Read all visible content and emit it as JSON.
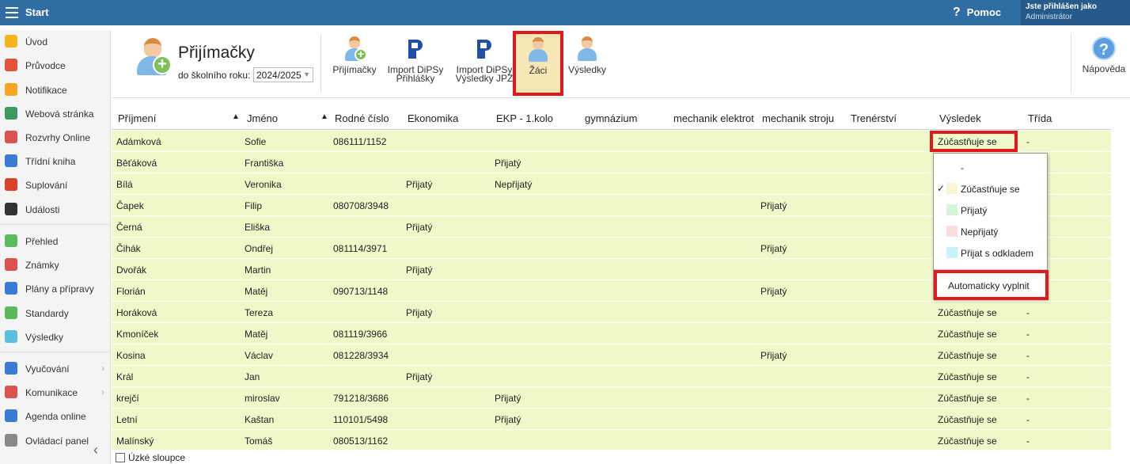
{
  "topbar": {
    "title": "Start",
    "help": "Pomoc",
    "user_line1": "Jste přihlášen jako",
    "user_line2": "Administrátor"
  },
  "sidebar": {
    "items": [
      {
        "label": "Úvod",
        "icon": "star-icon",
        "color": "#f3b51b"
      },
      {
        "label": "Průvodce",
        "icon": "wand-icon",
        "color": "#e2533a"
      },
      {
        "label": "Notifikace",
        "icon": "envelope-icon",
        "color": "#f5a623"
      },
      {
        "label": "Webová stránka",
        "icon": "home-icon",
        "color": "#3c9a5f"
      },
      {
        "label": "Rozvrhy Online",
        "icon": "calendar-grid-icon",
        "color": "#d9534f"
      },
      {
        "label": "Třídní kniha",
        "icon": "book-icon",
        "color": "#3a7bd5"
      },
      {
        "label": "Suplování",
        "icon": "person-swap-icon",
        "color": "#d9412b"
      },
      {
        "label": "Události",
        "icon": "calendar-icon",
        "color": "#333333"
      },
      {
        "label": "Přehled",
        "icon": "check-circle-icon",
        "color": "#5cb85c"
      },
      {
        "label": "Známky",
        "icon": "grades-icon",
        "color": "#d9534f"
      },
      {
        "label": "Plány a přípravy",
        "icon": "briefcase-icon",
        "color": "#3a7bd5"
      },
      {
        "label": "Standardy",
        "icon": "shield-check-icon",
        "color": "#5cb85c"
      },
      {
        "label": "Výsledky",
        "icon": "bar-chart-icon",
        "color": "#5bc0de"
      },
      {
        "label": "Vyučování",
        "icon": "open-book-icon",
        "color": "#3a7bd5"
      },
      {
        "label": "Komunikace",
        "icon": "chat-icon",
        "color": "#d9534f"
      },
      {
        "label": "Agenda online",
        "icon": "pen-icon",
        "color": "#3a7bd5"
      },
      {
        "label": "Ovládací panel",
        "icon": "gear-icon",
        "color": "#888888"
      }
    ]
  },
  "toolbar": {
    "title": "Přijímačky",
    "year_label": "do školního roku:",
    "year_value": "2024/2025",
    "buttons": [
      {
        "label": "Přijímačky"
      },
      {
        "label": "Import DiPSy",
        "label2": "Přihlášky"
      },
      {
        "label": "Import DiPSy",
        "label2": "Výsledky JPZ"
      },
      {
        "label": "Žáci"
      },
      {
        "label": "Výsledky"
      }
    ],
    "help_label": "Nápověda"
  },
  "table": {
    "headers": [
      "Příjmení",
      "Jméno",
      "Rodné číslo",
      "Ekonomika",
      "EKP - 1.kolo",
      "gymnázium",
      "mechanik elektrot",
      "mechanik stroju",
      "Trenérství",
      "Výsledek",
      "Třída"
    ],
    "rows": [
      [
        "Adámková",
        "Sofie",
        "086111/1152",
        "",
        "",
        "",
        "",
        "",
        "",
        "Zúčastňuje se",
        "-"
      ],
      [
        "Běťáková",
        "Františka",
        "",
        "",
        "Přijatý",
        "",
        "",
        "",
        "",
        "",
        ""
      ],
      [
        "Bílá",
        "Veronika",
        "",
        "Přijatý",
        "Nepřijatý",
        "",
        "",
        "",
        "",
        "",
        ""
      ],
      [
        "Čapek",
        "Filip",
        "080708/3948",
        "",
        "",
        "",
        "",
        "Přijatý",
        "",
        "",
        ""
      ],
      [
        "Černá",
        "Eliška",
        "",
        "Přijatý",
        "",
        "",
        "",
        "",
        "",
        "",
        ""
      ],
      [
        "Čihák",
        "Ondřej",
        "081114/3971",
        "",
        "",
        "",
        "",
        "Přijatý",
        "",
        "",
        ""
      ],
      [
        "Dvořák",
        "Martin",
        "",
        "Přijatý",
        "",
        "",
        "",
        "",
        "",
        "",
        ""
      ],
      [
        "Florián",
        "Matěj",
        "090713/1148",
        "",
        "",
        "",
        "",
        "Přijatý",
        "",
        "",
        ""
      ],
      [
        "Horáková",
        "Tereza",
        "",
        "Přijatý",
        "",
        "",
        "",
        "",
        "",
        "Zúčastňuje se",
        "-"
      ],
      [
        "Kmoníček",
        "Matěj",
        "081119/3966",
        "",
        "",
        "",
        "",
        "",
        "",
        "Zúčastňuje se",
        "-"
      ],
      [
        "Kosina",
        "Václav",
        "081228/3934",
        "",
        "",
        "",
        "",
        "Přijatý",
        "",
        "Zúčastňuje se",
        "-"
      ],
      [
        "Král",
        "Jan",
        "",
        "Přijatý",
        "",
        "",
        "",
        "",
        "",
        "Zúčastňuje se",
        "-"
      ],
      [
        "krejčí",
        "miroslav",
        "791218/3686",
        "",
        "Přijatý",
        "",
        "",
        "",
        "",
        "Zúčastňuje se",
        "-"
      ],
      [
        "Letní",
        "Kaštan",
        "110101/5498",
        "",
        "Přijatý",
        "",
        "",
        "",
        "",
        "Zúčastňuje se",
        "-"
      ],
      [
        "Malínský",
        "Tomáš",
        "080513/1162",
        "",
        "",
        "",
        "",
        "",
        "",
        "Zúčastňuje se",
        "-"
      ]
    ]
  },
  "dropdown": {
    "items": [
      {
        "label": "-",
        "color": "",
        "checked": false
      },
      {
        "label": "Zúčastňuje se",
        "color": "#f7f7d6",
        "checked": true
      },
      {
        "label": "Přijatý",
        "color": "#d6f5d6",
        "checked": false
      },
      {
        "label": "Nepřijatý",
        "color": "#f8dede",
        "checked": false
      },
      {
        "label": "Přijat s odkladem",
        "color": "#c9f4f7",
        "checked": false
      }
    ],
    "check_mark": "✓",
    "auto_fill": "Automaticky vyplnit"
  },
  "footer": {
    "narrow_columns": "Úzké sloupce"
  }
}
